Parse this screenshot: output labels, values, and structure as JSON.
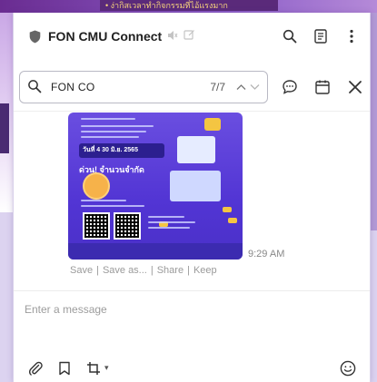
{
  "background": {
    "banner_text": "• ง่ากิสเวลาทำกิจกรรมที่ไอ้แรงมาก"
  },
  "header": {
    "title": "FON CMU Connect",
    "icons": [
      "shield-icon",
      "muted-speaker-icon",
      "edit-icon",
      "search-icon",
      "notes-icon",
      "more-icon"
    ]
  },
  "search": {
    "value": "FON CO",
    "count": "7/7"
  },
  "message": {
    "poster": {
      "date_text": "วันที่ 4   30 มิ.ย. 2565",
      "note_text": "ด่วน! จำนวนจำกัด"
    },
    "time": "9:29 AM",
    "actions": [
      "Save",
      "Save as...",
      "Share",
      "Keep"
    ]
  },
  "composer": {
    "placeholder": "Enter a message"
  },
  "colors": {
    "accent": "#5235d4",
    "frame": "#dcd3f0"
  }
}
